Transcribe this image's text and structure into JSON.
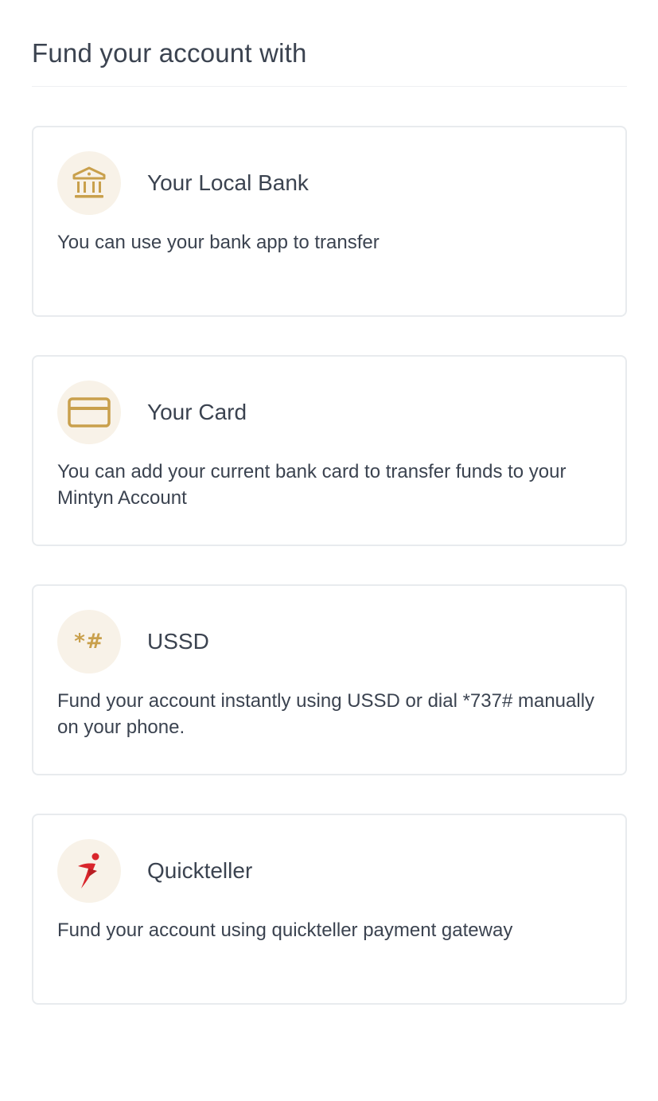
{
  "page": {
    "title": "Fund your account with"
  },
  "options": [
    {
      "title": "Your Local Bank",
      "description": "You can use your bank app to transfer",
      "icon": "bank-icon"
    },
    {
      "title": "Your Card",
      "description": "You can add your current bank card to transfer funds to your Mintyn Account",
      "icon": "card-icon"
    },
    {
      "title": "USSD",
      "description": "Fund your account instantly using USSD or dial *737# manually on your phone.",
      "icon": "ussd-icon",
      "icon_text": "*#"
    },
    {
      "title": "Quickteller",
      "description": "Fund your account using quickteller payment gateway",
      "icon": "quickteller-logo-icon"
    }
  ],
  "colors": {
    "accent_gold": "#c9a04c",
    "icon_bg": "#f8f2e8",
    "text": "#3b4350",
    "card_border": "#e8ebee",
    "quickteller_red": "#d9262c"
  }
}
